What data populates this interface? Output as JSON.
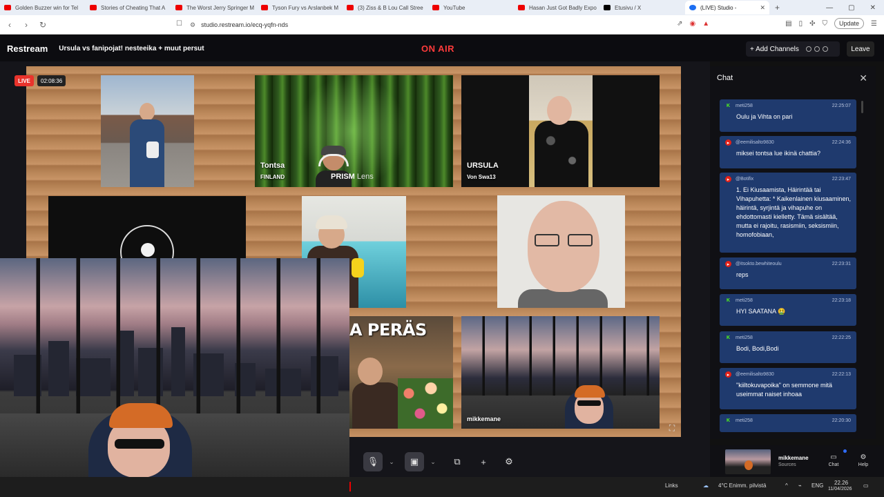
{
  "browser": {
    "tabs": [
      {
        "label": "Golden Buzzer win for Tel",
        "icon": "youtube-icon"
      },
      {
        "label": "Stories of Cheating That A",
        "icon": "youtube-icon"
      },
      {
        "label": "The Worst Jerry Springer M",
        "icon": "youtube-icon"
      },
      {
        "label": "Tyson Fury vs Arslanbek M",
        "icon": "youtube-icon"
      },
      {
        "label": "(3) Ziss & B Lou Call Stree",
        "icon": "youtube-icon"
      },
      {
        "label": "YouTube",
        "icon": "youtube-icon"
      },
      {
        "label": "Hasan Just Got Badly Expo",
        "icon": "youtube-icon"
      },
      {
        "label": "Etusivu / X",
        "icon": "x-icon"
      },
      {
        "label": "(LIVE) Studio -",
        "icon": "restream-icon"
      }
    ],
    "new_tab": "+",
    "window_controls": [
      "—",
      "▢",
      "✕"
    ],
    "url": "studio.restream.io/ecq-yqfn-nds",
    "update_label": "Update"
  },
  "app": {
    "brand": "Restream",
    "stream_title": "Ursula vs fanipojat! nesteeika + muut persut",
    "on_air": "ON AIR",
    "add_channels": "+ Add Channels",
    "leave": "Leave"
  },
  "stage": {
    "live_badge": "LIVE",
    "timer": "02:08:36",
    "tiles": {
      "tontsa": {
        "name": "Tontsa",
        "sub": "FINLAND"
      },
      "ursula": {
        "name": "URSULA",
        "sub": "Von Swa13"
      },
      "prism": {
        "brand": "PRISM",
        "suffix": "Lens"
      },
      "peras": {
        "overlay": "A PERÄS"
      },
      "mikke": {
        "name": "mikkemane"
      }
    }
  },
  "chat": {
    "title": "Chat",
    "messages": [
      {
        "platform": "kick",
        "user": "meti258",
        "time": "22:25:07",
        "text": "Oulu ja Vihta on pari"
      },
      {
        "platform": "youtube",
        "user": "@eemilisalto9830",
        "time": "22:24:36",
        "text": "miksei tontsa lue ikinä chattia?"
      },
      {
        "platform": "youtube",
        "user": "@Botifix",
        "time": "22:23:47",
        "text": "1. Ei Kiusaamista, Häirintää tai Vihapuhetta: * Kaikenlainen kiusaaminen, häirintä, syrjintä ja vihapuhe on ehdottomasti kielletty. Tämä sisältää, mutta ei rajoitu, rasismiin, seksismiin, homofobiaan,"
      },
      {
        "platform": "youtube",
        "user": "@itsokto.bewhiteoulu",
        "time": "22:23:31",
        "text": "reps"
      },
      {
        "platform": "kick",
        "user": "meti258",
        "time": "22:23:18",
        "text": "HYI SAATANA 🤮"
      },
      {
        "platform": "kick",
        "user": "meti258",
        "time": "22:22:25",
        "text": "Bodi, Bodi,Bodi"
      },
      {
        "platform": "youtube",
        "user": "@eemilisalto9830",
        "time": "22:22:13",
        "text": "\"kiiltokuvapoika\" on semmone mitä useimmat naiset inhoaa"
      },
      {
        "platform": "kick",
        "user": "meti258",
        "time": "22:20:30",
        "text": ""
      }
    ]
  },
  "bottom": {
    "source_name": "mikkemane",
    "source_sub": "Sources",
    "chat_label": "Chat",
    "help_label": "Help"
  },
  "taskbar": {
    "links": "Links",
    "weather": "4°C  Enimm. pilvistä",
    "lang": "ENG",
    "time": "22.26",
    "date": "11/04/2026"
  },
  "colors": {
    "on_air": "#ff3b3b",
    "live": "#e9332c",
    "chat_bubble": "#1f3a6e",
    "kick": "#53fc18",
    "youtube": "#e62117"
  }
}
